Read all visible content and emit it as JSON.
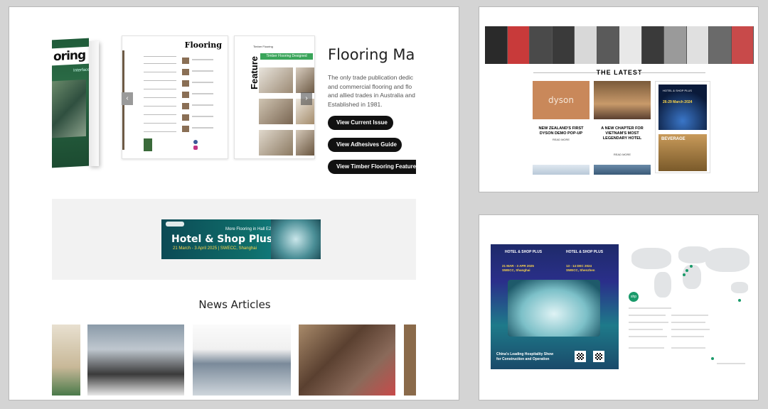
{
  "main": {
    "magazine": {
      "cover_logo": "oring",
      "cover_sub": "Interface",
      "page_heading": "Flooring",
      "feature_label": "Feature",
      "feature_tag": "Timber Flooring Designed",
      "page_small": "Timber Flooring"
    },
    "carousel": {
      "prev_icon": "‹",
      "next_icon": "›"
    },
    "hero": {
      "title": "Flooring Ma",
      "description": "The only trade publication dedic\nand commercial flooring and flo\nand allied trades in Australia and\nEstablished in 1981.",
      "buttons": [
        "View Current Issue",
        "View Adhesives Guide",
        "View Timber Flooring Feature"
      ]
    },
    "banner": {
      "top_text": "More Flooring in Hall E2",
      "title": "Hotel & Shop Plus",
      "subtitle": "21 March - 3 April 2025 | SWECC, Shanghai"
    },
    "news": {
      "heading": "News Articles"
    }
  },
  "latest": {
    "heading": "THE LATEST",
    "cards": [
      {
        "image_text": "dyson",
        "title": "NEW ZEALAND'S FIRST DYSON DEMO POP-UP",
        "read_more": "READ MORE"
      },
      {
        "image_text": "",
        "title": "A NEW CHAPTER FOR VIETNAM'S MOST LEGENDARY HOTEL",
        "read_more": "READ MORE"
      }
    ],
    "side_ad": {
      "top_text": "HOTEL & SHOP PLUS",
      "date": "26-29 March 2024",
      "bottom_text": "BEVERAGE"
    }
  },
  "ad": {
    "logo_left": "HOTEL & SHOP PLUS",
    "logo_right": "HOTEL & SHOP PLUS",
    "date_left": "21 MAR - 3 APR 2025\nSWECC, Shanghai",
    "date_right": "13 - 14 DEC 2024\nSWECC, Shenzhen",
    "tagline": "China's Leading Hospitality Show\nfor Construction and Operation",
    "badge": "shp"
  },
  "colors": {
    "accent": "#111111",
    "background": "#d4d4d4",
    "teal": "#0f6d6a",
    "green_dot": "#1a9a6a"
  }
}
